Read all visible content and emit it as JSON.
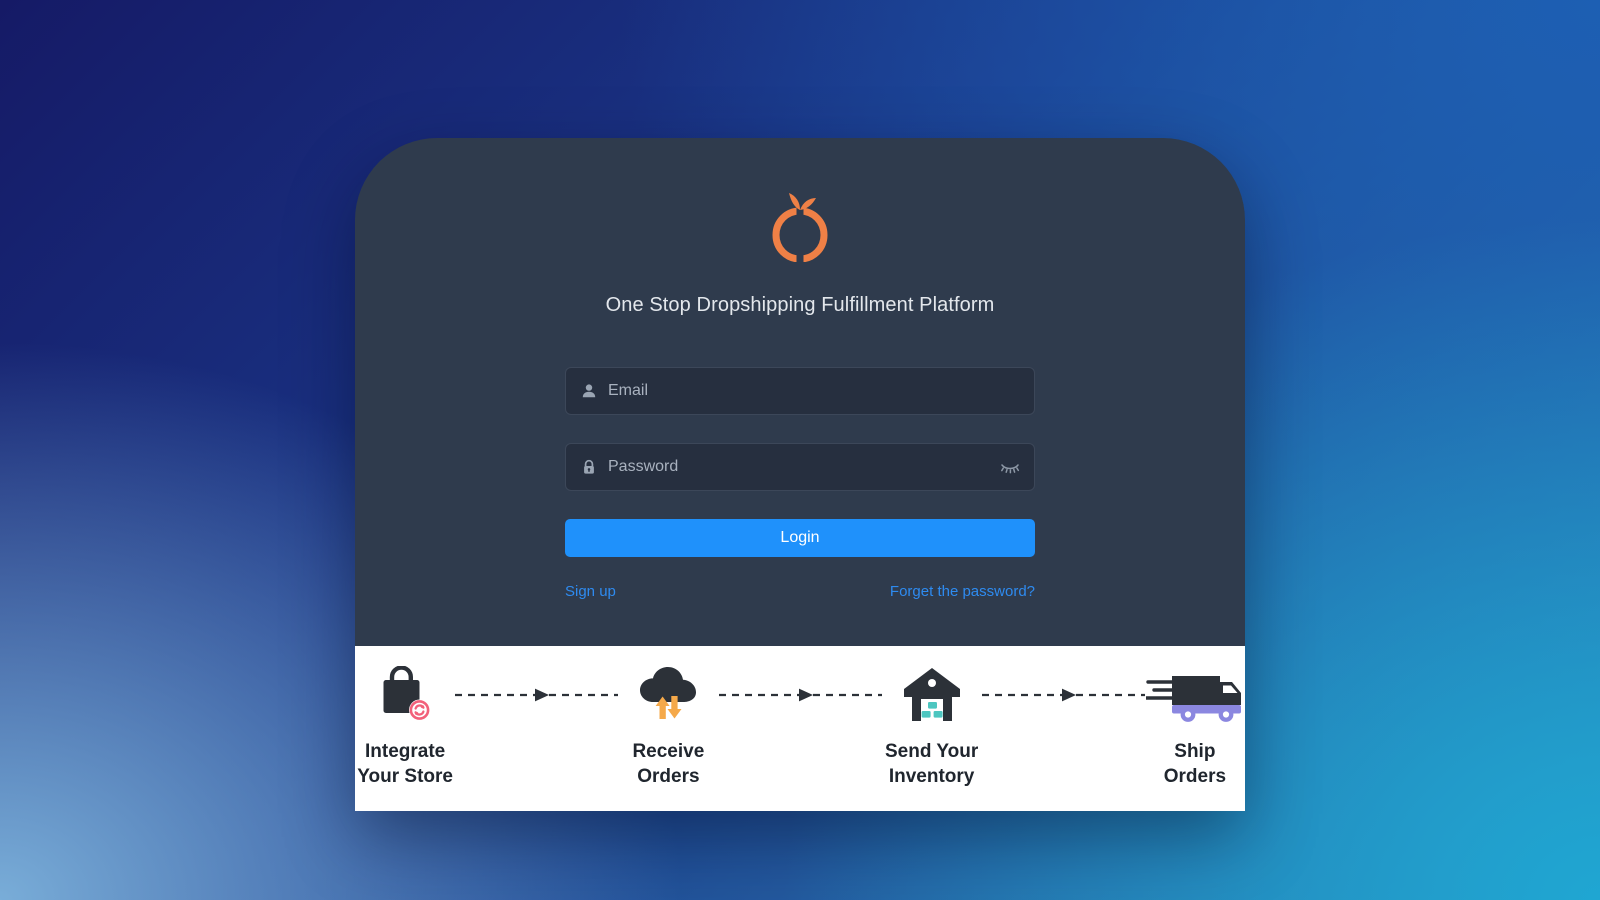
{
  "brand": {
    "logo_icon": "orange-fruit-logo",
    "logo_color": "#ef8046",
    "tagline": "One Stop Dropshipping Fulfillment Platform"
  },
  "form": {
    "email": {
      "icon": "user-icon",
      "placeholder": "Email",
      "value": ""
    },
    "password": {
      "icon": "lock-icon",
      "placeholder": "Password",
      "value": "",
      "toggle_icon": "eye-off-icon"
    },
    "login_label": "Login",
    "login_color": "#1f91fb",
    "signup_label": "Sign up",
    "forgot_label": "Forget the password?",
    "link_color": "#2e8bf0"
  },
  "steps": {
    "connector_icon": "dashed-arrow-icon",
    "items": [
      {
        "icon": "shopping-bag-sync-icon",
        "label": "Integrate Your Store",
        "accent": "#f2617a"
      },
      {
        "icon": "cloud-transfer-icon",
        "label": "Receive Orders",
        "accent": "#f5a94a"
      },
      {
        "icon": "warehouse-icon",
        "label": "Send Your Inventory",
        "accent": "#4dc6c0"
      },
      {
        "icon": "delivery-truck-icon",
        "label": "Ship Orders",
        "accent": "#8b87e0"
      }
    ]
  },
  "theme": {
    "card_bg": "#2f3b4d",
    "field_bg": "#262f3f",
    "bg_top_left": "#151a66",
    "bg_top_right": "#1d5fb3",
    "bg_bottom_left": "#79add8",
    "bg_bottom_right": "#1fa6d2"
  }
}
